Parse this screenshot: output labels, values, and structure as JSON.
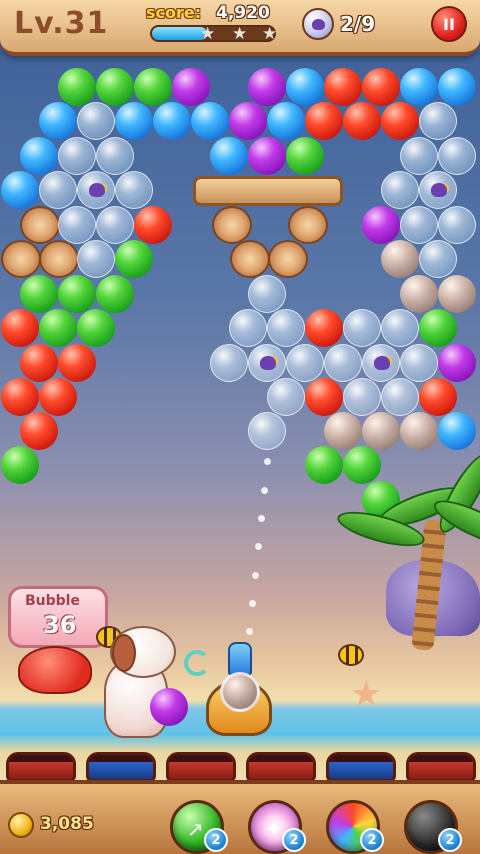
{
  "hud": {
    "level": "Lv.31",
    "score_label": "score:",
    "score_value": "4,920",
    "goal_count": "2/9",
    "progress_fraction": 0.45,
    "pause_symbol": "II"
  },
  "sign": {
    "title": "Bubble",
    "number": "36"
  },
  "footer": {
    "coins": "3,085",
    "boosters": [
      {
        "name": "arrow-booster",
        "count": "2"
      },
      {
        "name": "lightning-booster",
        "count": "2"
      },
      {
        "name": "rainbow-booster",
        "count": "2"
      },
      {
        "name": "bomb-booster",
        "count": "2"
      }
    ]
  },
  "icons": {
    "coin": "paw-coin-icon",
    "goal": "bird-icon",
    "swap": "swap-arrows-icon"
  },
  "colors": {
    "bubble_green": "#52d43a",
    "bubble_blue": "#3fb6ff",
    "bubble_red": "#ff4a2a",
    "bubble_purple": "#c23be8",
    "current_shot": "stone",
    "next_shot": "purple"
  }
}
